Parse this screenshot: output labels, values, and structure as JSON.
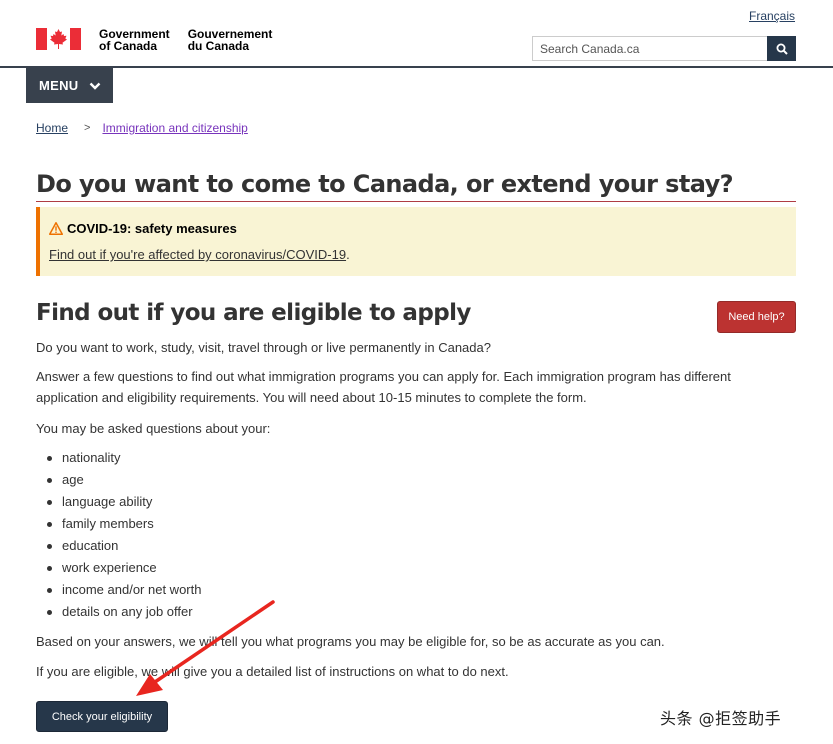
{
  "header": {
    "signature_en_line1": "Government",
    "signature_en_line2": "of Canada",
    "signature_fr_line1": "Gouvernement",
    "signature_fr_line2": "du Canada",
    "language_link": "Français",
    "search": {
      "placeholder": "Search Canada.ca"
    },
    "brand_color": "#26374a",
    "flag_color": "#eb2d37"
  },
  "menu": {
    "label": "MENU"
  },
  "breadcrumb": [
    "Home",
    "Immigration and citizenship"
  ],
  "page_title": "Do you want to come to Canada, or extend your stay?",
  "alert": {
    "title": "COVID-19: safety measures",
    "link_text": "Find out if you're affected by coronavirus/COVID-19",
    "link_suffix": "."
  },
  "eligibility": {
    "title": "Find out if you are eligible to apply",
    "help_button": "Need help?",
    "intro": "Do you want to work, study, visit, travel through or live permanently in Canada?",
    "description": "Answer a few questions to find out what immigration programs you can apply for. Each immigration program has different application and eligibility requirements. You will need about 10-15 minutes to complete the form.",
    "questions_intro": "You may be asked questions about your:",
    "topics": [
      "nationality",
      "age",
      "language ability",
      "family members",
      "education",
      "work experience",
      "income and/or net worth",
      "details on any job offer"
    ],
    "results_text": "Based on your answers, we will tell you what programs you may be eligible for, so be as accurate as you can.",
    "next_text": "If you are eligible, we will give you a detailed list of instructions on what to do next.",
    "check_button": "Check your eligibility"
  },
  "annotation_color": "#e8261f",
  "watermark": "头条 @拒签助手"
}
